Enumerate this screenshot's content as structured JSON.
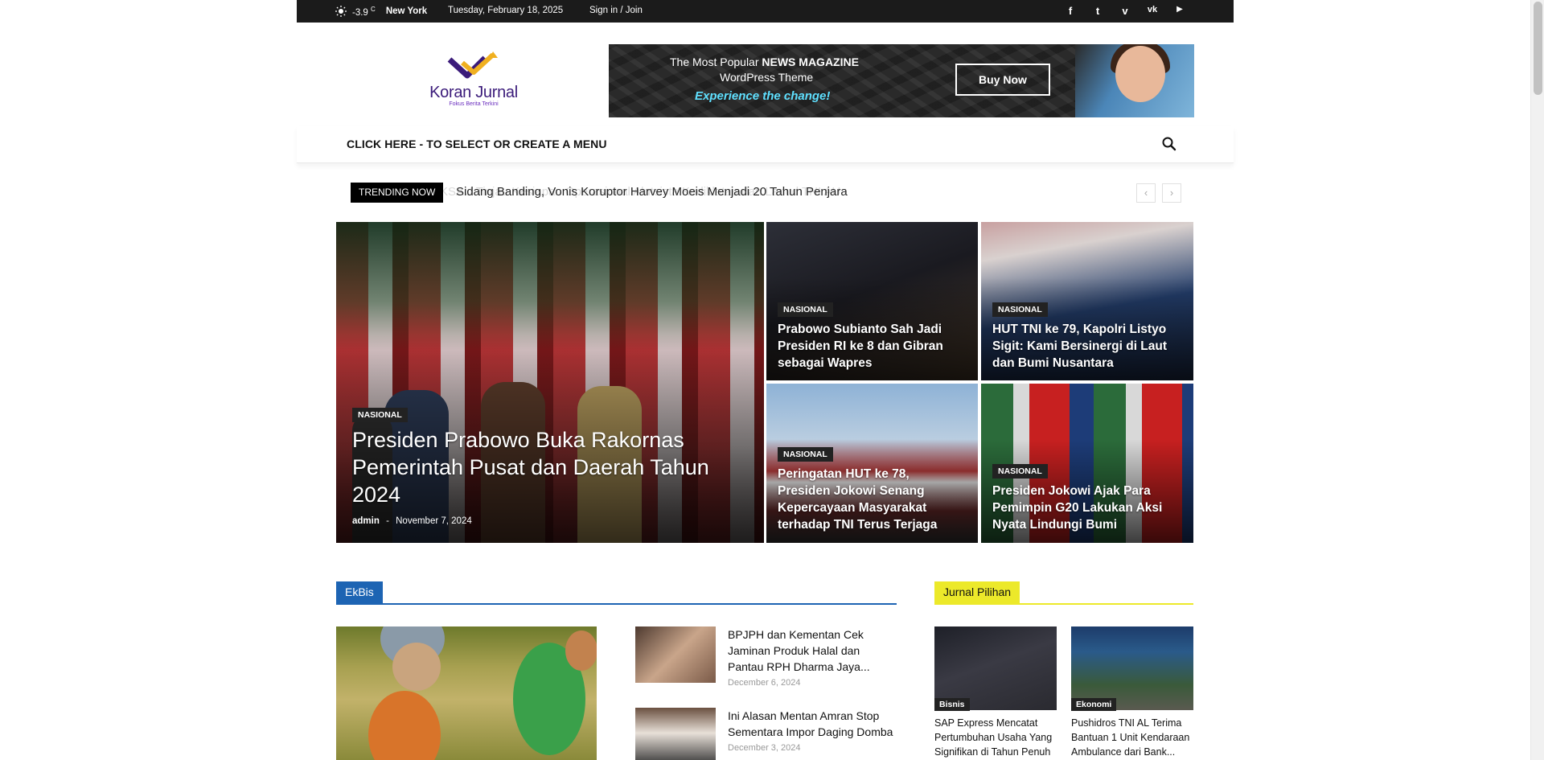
{
  "topbar": {
    "temperature": "-3.9",
    "temp_unit": "C",
    "city": "New York",
    "date": "Tuesday, February 18, 2025",
    "signin": "Sign in / Join",
    "socials": [
      {
        "icon": "facebook-icon",
        "glyph": "f"
      },
      {
        "icon": "twitter-icon",
        "glyph": "t"
      },
      {
        "icon": "vimeo-icon",
        "glyph": "v"
      },
      {
        "icon": "vk-icon",
        "glyph": "vk"
      },
      {
        "icon": "youtube-icon",
        "glyph": "▶"
      }
    ]
  },
  "logo": {
    "name": "Koran Jurnal",
    "tagline": "Fokus Berita Terkini"
  },
  "ad": {
    "line1_pre": "The Most Popular ",
    "line1_bold": "NEWS MAGAZINE",
    "line2": "WordPress Theme",
    "line3": "Experience the change!",
    "button": "Buy Now"
  },
  "nav": {
    "menu_label": "CLICK HERE - TO SELECT OR CREATE A MENU",
    "search_icon": "search-icon"
  },
  "trending": {
    "label": "TRENDING NOW",
    "headline": "Sidang Banding, Vonis Koruptor Harvey Moeis Menjadi 20 Tahun Penjara",
    "ghost": "KSAU Tinjau Kesiapan Operasional Alutsista Kodiklatau dan Lanud TNI AU",
    "prev": "‹",
    "next": "›"
  },
  "featured": {
    "main": {
      "category": "NASIONAL",
      "title": "Presiden Prabowo Buka Rakornas Pemerintah Pusat dan Daerah Tahun 2024",
      "author": "admin",
      "separator": "-",
      "date": "November 7, 2024"
    },
    "small": [
      {
        "category": "NASIONAL",
        "title": "Prabowo Subianto Sah Jadi Presiden RI ke 8 dan Gibran sebagai Wapres"
      },
      {
        "category": "NASIONAL",
        "title": "HUT TNI ke 79, Kapolri Listyo Sigit: Kami Bersinergi di Laut dan Bumi Nusantara"
      },
      {
        "category": "NASIONAL",
        "title": "Peringatan HUT ke 78, Presiden Jokowi Senang Kepercayaan Masyarakat terhadap TNI Terus Terjaga"
      },
      {
        "category": "NASIONAL",
        "title": "Presiden Jokowi Ajak Para Pemimpin G20 Lakukan Aksi Nyata Lindungi Bumi"
      }
    ]
  },
  "ekbis": {
    "heading": "EkBis",
    "items": [
      {
        "title": "BPJPH dan Kementan Cek Jaminan Produk Halal dan Pantau RPH Dharma Jaya...",
        "date": "December 6, 2024"
      },
      {
        "title": "Ini Alasan Mentan Amran Stop Sementara Impor Daging Domba",
        "date": "December 3, 2024"
      }
    ]
  },
  "jurnal": {
    "heading": "Jurnal Pilihan",
    "items": [
      {
        "category": "Bisnis",
        "title": "SAP Express Mencatat Pertumbuhan Usaha Yang Signifikan di Tahun Penuh"
      },
      {
        "category": "Ekonomi",
        "title": "Pushidros TNI AL Terima Bantuan 1 Unit Kendaraan Ambulance dari Bank..."
      }
    ]
  },
  "colors": {
    "topbar": "#1b1b1b",
    "ekbis_accent": "#1d64b3",
    "jurnal_accent": "#ece92a",
    "logo_purple": "#3b1b7a",
    "logo_gold": "#f0b020"
  }
}
